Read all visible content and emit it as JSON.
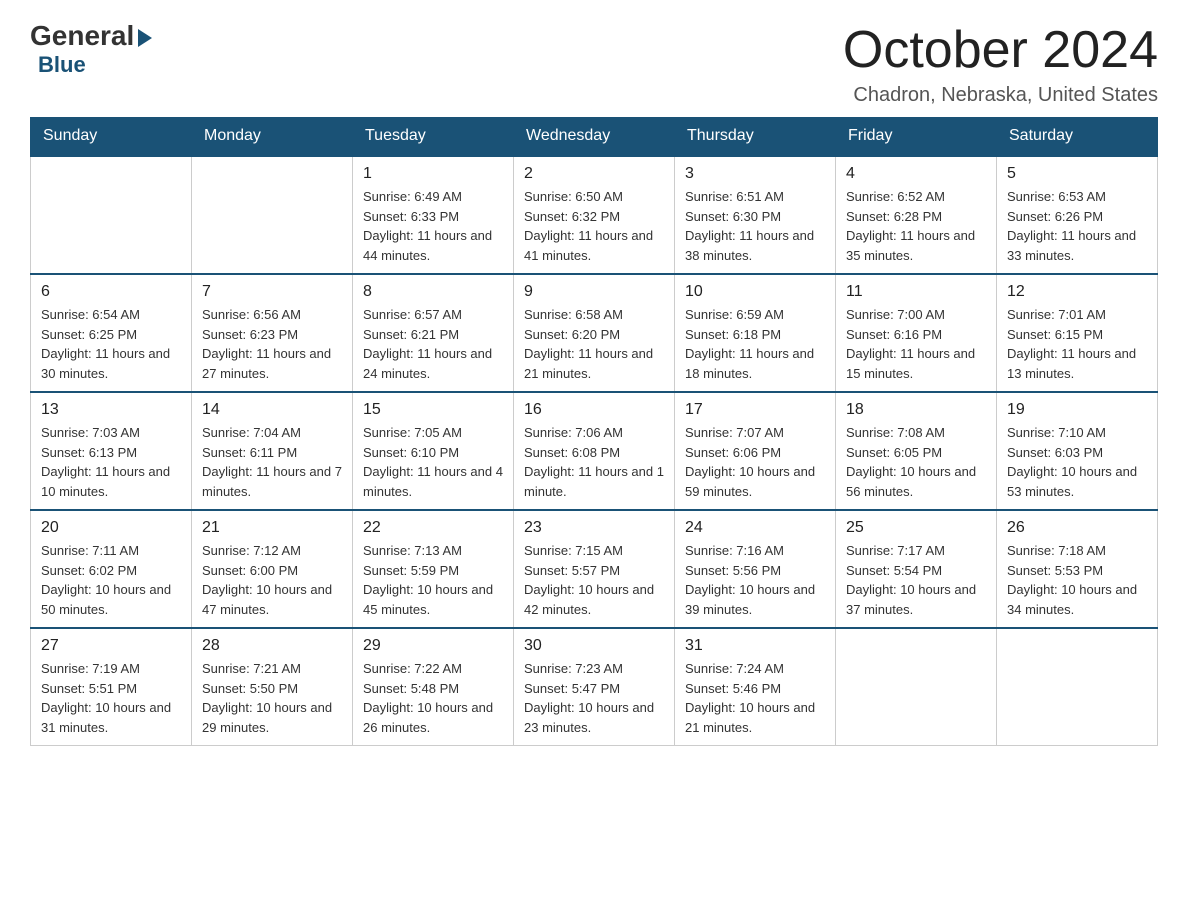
{
  "header": {
    "logo_general": "General",
    "logo_blue": "Blue",
    "month_title": "October 2024",
    "location": "Chadron, Nebraska, United States"
  },
  "days_of_week": [
    "Sunday",
    "Monday",
    "Tuesday",
    "Wednesday",
    "Thursday",
    "Friday",
    "Saturday"
  ],
  "weeks": [
    [
      {
        "day": "",
        "sunrise": "",
        "sunset": "",
        "daylight": ""
      },
      {
        "day": "",
        "sunrise": "",
        "sunset": "",
        "daylight": ""
      },
      {
        "day": "1",
        "sunrise": "Sunrise: 6:49 AM",
        "sunset": "Sunset: 6:33 PM",
        "daylight": "Daylight: 11 hours and 44 minutes."
      },
      {
        "day": "2",
        "sunrise": "Sunrise: 6:50 AM",
        "sunset": "Sunset: 6:32 PM",
        "daylight": "Daylight: 11 hours and 41 minutes."
      },
      {
        "day": "3",
        "sunrise": "Sunrise: 6:51 AM",
        "sunset": "Sunset: 6:30 PM",
        "daylight": "Daylight: 11 hours and 38 minutes."
      },
      {
        "day": "4",
        "sunrise": "Sunrise: 6:52 AM",
        "sunset": "Sunset: 6:28 PM",
        "daylight": "Daylight: 11 hours and 35 minutes."
      },
      {
        "day": "5",
        "sunrise": "Sunrise: 6:53 AM",
        "sunset": "Sunset: 6:26 PM",
        "daylight": "Daylight: 11 hours and 33 minutes."
      }
    ],
    [
      {
        "day": "6",
        "sunrise": "Sunrise: 6:54 AM",
        "sunset": "Sunset: 6:25 PM",
        "daylight": "Daylight: 11 hours and 30 minutes."
      },
      {
        "day": "7",
        "sunrise": "Sunrise: 6:56 AM",
        "sunset": "Sunset: 6:23 PM",
        "daylight": "Daylight: 11 hours and 27 minutes."
      },
      {
        "day": "8",
        "sunrise": "Sunrise: 6:57 AM",
        "sunset": "Sunset: 6:21 PM",
        "daylight": "Daylight: 11 hours and 24 minutes."
      },
      {
        "day": "9",
        "sunrise": "Sunrise: 6:58 AM",
        "sunset": "Sunset: 6:20 PM",
        "daylight": "Daylight: 11 hours and 21 minutes."
      },
      {
        "day": "10",
        "sunrise": "Sunrise: 6:59 AM",
        "sunset": "Sunset: 6:18 PM",
        "daylight": "Daylight: 11 hours and 18 minutes."
      },
      {
        "day": "11",
        "sunrise": "Sunrise: 7:00 AM",
        "sunset": "Sunset: 6:16 PM",
        "daylight": "Daylight: 11 hours and 15 minutes."
      },
      {
        "day": "12",
        "sunrise": "Sunrise: 7:01 AM",
        "sunset": "Sunset: 6:15 PM",
        "daylight": "Daylight: 11 hours and 13 minutes."
      }
    ],
    [
      {
        "day": "13",
        "sunrise": "Sunrise: 7:03 AM",
        "sunset": "Sunset: 6:13 PM",
        "daylight": "Daylight: 11 hours and 10 minutes."
      },
      {
        "day": "14",
        "sunrise": "Sunrise: 7:04 AM",
        "sunset": "Sunset: 6:11 PM",
        "daylight": "Daylight: 11 hours and 7 minutes."
      },
      {
        "day": "15",
        "sunrise": "Sunrise: 7:05 AM",
        "sunset": "Sunset: 6:10 PM",
        "daylight": "Daylight: 11 hours and 4 minutes."
      },
      {
        "day": "16",
        "sunrise": "Sunrise: 7:06 AM",
        "sunset": "Sunset: 6:08 PM",
        "daylight": "Daylight: 11 hours and 1 minute."
      },
      {
        "day": "17",
        "sunrise": "Sunrise: 7:07 AM",
        "sunset": "Sunset: 6:06 PM",
        "daylight": "Daylight: 10 hours and 59 minutes."
      },
      {
        "day": "18",
        "sunrise": "Sunrise: 7:08 AM",
        "sunset": "Sunset: 6:05 PM",
        "daylight": "Daylight: 10 hours and 56 minutes."
      },
      {
        "day": "19",
        "sunrise": "Sunrise: 7:10 AM",
        "sunset": "Sunset: 6:03 PM",
        "daylight": "Daylight: 10 hours and 53 minutes."
      }
    ],
    [
      {
        "day": "20",
        "sunrise": "Sunrise: 7:11 AM",
        "sunset": "Sunset: 6:02 PM",
        "daylight": "Daylight: 10 hours and 50 minutes."
      },
      {
        "day": "21",
        "sunrise": "Sunrise: 7:12 AM",
        "sunset": "Sunset: 6:00 PM",
        "daylight": "Daylight: 10 hours and 47 minutes."
      },
      {
        "day": "22",
        "sunrise": "Sunrise: 7:13 AM",
        "sunset": "Sunset: 5:59 PM",
        "daylight": "Daylight: 10 hours and 45 minutes."
      },
      {
        "day": "23",
        "sunrise": "Sunrise: 7:15 AM",
        "sunset": "Sunset: 5:57 PM",
        "daylight": "Daylight: 10 hours and 42 minutes."
      },
      {
        "day": "24",
        "sunrise": "Sunrise: 7:16 AM",
        "sunset": "Sunset: 5:56 PM",
        "daylight": "Daylight: 10 hours and 39 minutes."
      },
      {
        "day": "25",
        "sunrise": "Sunrise: 7:17 AM",
        "sunset": "Sunset: 5:54 PM",
        "daylight": "Daylight: 10 hours and 37 minutes."
      },
      {
        "day": "26",
        "sunrise": "Sunrise: 7:18 AM",
        "sunset": "Sunset: 5:53 PM",
        "daylight": "Daylight: 10 hours and 34 minutes."
      }
    ],
    [
      {
        "day": "27",
        "sunrise": "Sunrise: 7:19 AM",
        "sunset": "Sunset: 5:51 PM",
        "daylight": "Daylight: 10 hours and 31 minutes."
      },
      {
        "day": "28",
        "sunrise": "Sunrise: 7:21 AM",
        "sunset": "Sunset: 5:50 PM",
        "daylight": "Daylight: 10 hours and 29 minutes."
      },
      {
        "day": "29",
        "sunrise": "Sunrise: 7:22 AM",
        "sunset": "Sunset: 5:48 PM",
        "daylight": "Daylight: 10 hours and 26 minutes."
      },
      {
        "day": "30",
        "sunrise": "Sunrise: 7:23 AM",
        "sunset": "Sunset: 5:47 PM",
        "daylight": "Daylight: 10 hours and 23 minutes."
      },
      {
        "day": "31",
        "sunrise": "Sunrise: 7:24 AM",
        "sunset": "Sunset: 5:46 PM",
        "daylight": "Daylight: 10 hours and 21 minutes."
      },
      {
        "day": "",
        "sunrise": "",
        "sunset": "",
        "daylight": ""
      },
      {
        "day": "",
        "sunrise": "",
        "sunset": "",
        "daylight": ""
      }
    ]
  ]
}
